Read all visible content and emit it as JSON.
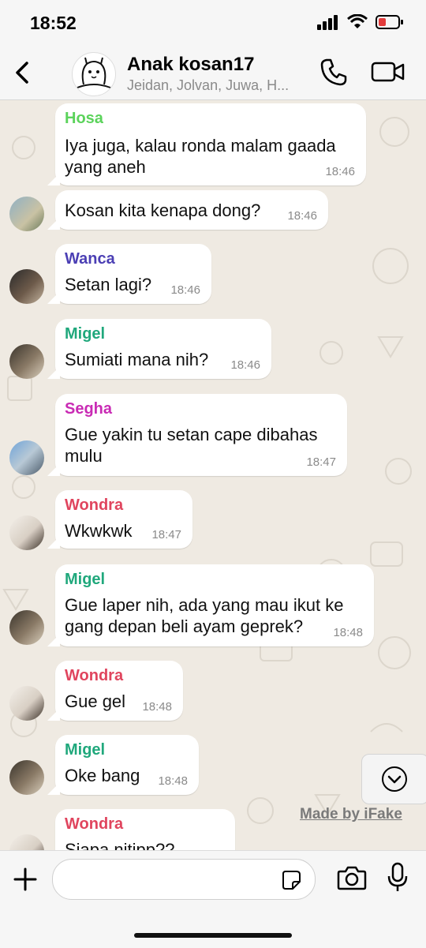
{
  "status": {
    "time": "18:52"
  },
  "header": {
    "title": "Anak kosan17",
    "subtitle": "Jeidan, Jolvan, Juwa, H..."
  },
  "messages": [
    {
      "sender": "Hosa",
      "text": "Iya juga, kalau ronda malam gaada yang aneh",
      "time": "18:46",
      "sender_color": "#5bd35b"
    },
    {
      "sender": "",
      "text": "Kosan kita kenapa dong?",
      "time": "18:46"
    },
    {
      "sender": "Wanca",
      "text": "Setan lagi?",
      "time": "18:46",
      "sender_color": "#4b3fb4"
    },
    {
      "sender": "Migel",
      "text": "Sumiati mana nih?",
      "time": "18:46",
      "sender_color": "#20a87c"
    },
    {
      "sender": "Segha",
      "text": "Gue yakin tu setan cape dibahas mulu",
      "time": "18:47",
      "sender_color": "#c92bb4"
    },
    {
      "sender": "Wondra",
      "text": "Wkwkwk",
      "time": "18:47",
      "sender_color": "#e0455e"
    },
    {
      "sender": "Migel",
      "text": "Gue laper nih, ada yang mau ikut ke gang depan beli ayam geprek?",
      "time": "18:48",
      "sender_color": "#20a87c"
    },
    {
      "sender": "Wondra",
      "text": "Gue gel",
      "time": "18:48",
      "sender_color": "#e0455e"
    },
    {
      "sender": "Migel",
      "text": "Oke bang",
      "time": "18:48",
      "sender_color": "#20a87c"
    },
    {
      "sender": "Wondra",
      "text": "Siapa nitipp??",
      "time": "",
      "sender_color": "#e0455e"
    }
  ],
  "watermark": "Made by iFake",
  "input": {
    "placeholder": ""
  }
}
